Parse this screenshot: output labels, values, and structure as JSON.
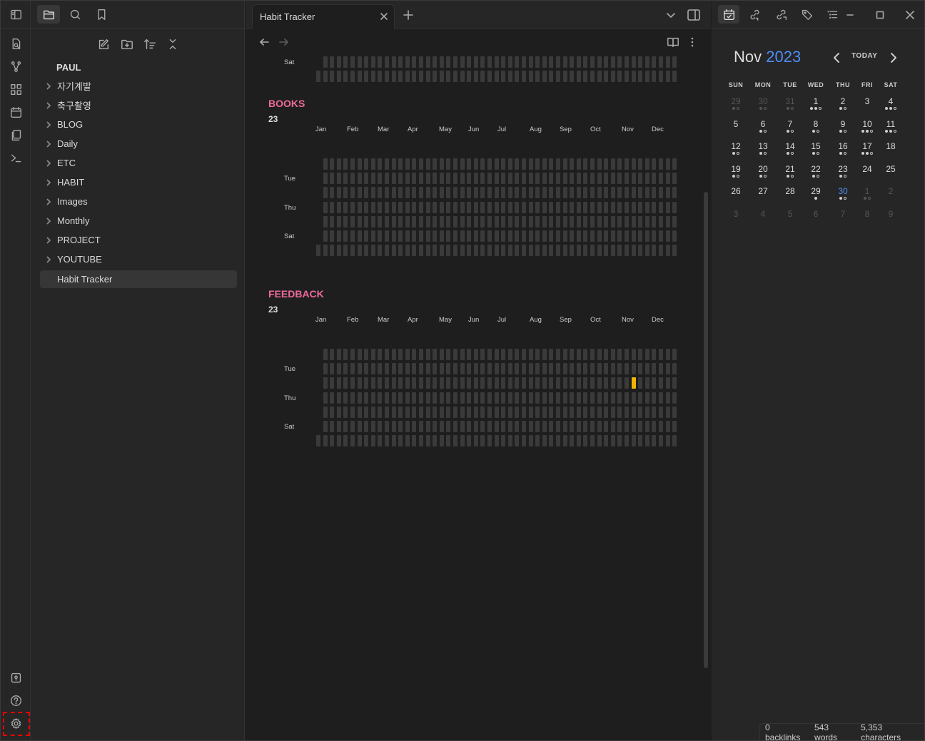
{
  "vault": {
    "name": "PAUL"
  },
  "tree": [
    {
      "label": "자기계발"
    },
    {
      "label": "축구촬영"
    },
    {
      "label": "BLOG"
    },
    {
      "label": "Daily"
    },
    {
      "label": "ETC"
    },
    {
      "label": "HABIT"
    },
    {
      "label": "Images"
    },
    {
      "label": "Monthly"
    },
    {
      "label": "PROJECT"
    },
    {
      "label": "YOUTUBE"
    }
  ],
  "active_file": "Habit Tracker",
  "tab": {
    "title": "Habit Tracker"
  },
  "tracker": {
    "months": [
      "Jan",
      "Feb",
      "Mar",
      "Apr",
      "May",
      "Jun",
      "Jul",
      "Aug",
      "Sep",
      "Oct",
      "Nov",
      "Dec"
    ],
    "day_labels": [
      "Tue",
      "Thu",
      "Sat"
    ],
    "top_partial_label": "Sat",
    "highlight_color": "#f2b400",
    "sections": [
      {
        "title": "BOOKS",
        "year": "23",
        "filled": []
      },
      {
        "title": "FEEDBACK",
        "year": "23",
        "filled": [
          {
            "week": 46,
            "row": 2
          }
        ]
      }
    ]
  },
  "calendar": {
    "month": "Nov",
    "year": "2023",
    "today_label": "TODAY",
    "weekdays": [
      "SUN",
      "MON",
      "TUE",
      "WED",
      "THU",
      "FRI",
      "SAT"
    ],
    "weeks": [
      [
        {
          "d": "29",
          "m": true,
          "dots": "fh"
        },
        {
          "d": "30",
          "m": true,
          "dots": "fh"
        },
        {
          "d": "31",
          "m": true,
          "dots": "fh"
        },
        {
          "d": "1",
          "dots": "ffh"
        },
        {
          "d": "2",
          "dots": "fh"
        },
        {
          "d": "3",
          "dots": ""
        },
        {
          "d": "4",
          "dots": "ffh"
        }
      ],
      [
        {
          "d": "5",
          "dots": ""
        },
        {
          "d": "6",
          "dots": "fh"
        },
        {
          "d": "7",
          "dots": "fh"
        },
        {
          "d": "8",
          "dots": "fh"
        },
        {
          "d": "9",
          "dots": "fh"
        },
        {
          "d": "10",
          "dots": "ffh"
        },
        {
          "d": "11",
          "dots": "ffh"
        }
      ],
      [
        {
          "d": "12",
          "dots": "fh"
        },
        {
          "d": "13",
          "dots": "fh"
        },
        {
          "d": "14",
          "dots": "fh"
        },
        {
          "d": "15",
          "dots": "fh"
        },
        {
          "d": "16",
          "dots": "fh"
        },
        {
          "d": "17",
          "dots": "ffh"
        },
        {
          "d": "18",
          "dots": ""
        }
      ],
      [
        {
          "d": "19",
          "dots": "fh"
        },
        {
          "d": "20",
          "dots": "fh"
        },
        {
          "d": "21",
          "dots": "fh"
        },
        {
          "d": "22",
          "dots": "fh"
        },
        {
          "d": "23",
          "dots": "fh"
        },
        {
          "d": "24",
          "dots": ""
        },
        {
          "d": "25",
          "dots": ""
        }
      ],
      [
        {
          "d": "26",
          "dots": ""
        },
        {
          "d": "27",
          "dots": ""
        },
        {
          "d": "28",
          "dots": ""
        },
        {
          "d": "29",
          "dots": "f"
        },
        {
          "d": "30",
          "today": true,
          "dots": "fh"
        },
        {
          "d": "1",
          "m": true,
          "dots": "fh"
        },
        {
          "d": "2",
          "m": true,
          "dots": ""
        }
      ],
      [
        {
          "d": "3",
          "m": true,
          "dots": ""
        },
        {
          "d": "4",
          "m": true,
          "dots": ""
        },
        {
          "d": "5",
          "m": true,
          "dots": ""
        },
        {
          "d": "6",
          "m": true,
          "dots": ""
        },
        {
          "d": "7",
          "m": true,
          "dots": ""
        },
        {
          "d": "8",
          "m": true,
          "dots": ""
        },
        {
          "d": "9",
          "m": true,
          "dots": ""
        }
      ]
    ]
  },
  "status": {
    "backlinks": "0 backlinks",
    "words": "543 words",
    "characters": "5,353 characters"
  }
}
